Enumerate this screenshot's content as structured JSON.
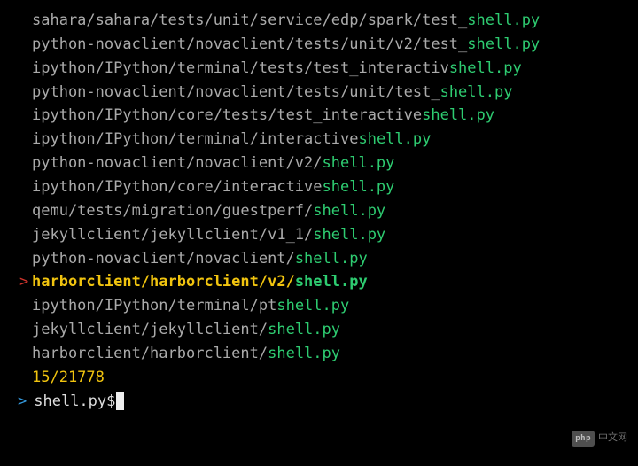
{
  "results": [
    {
      "prefix": "sahara/sahara/tests/unit/service/edp/spark/test_",
      "match": "shell.py",
      "selected": false
    },
    {
      "prefix": "python-novaclient/novaclient/tests/unit/v2/test_",
      "match": "shell.py",
      "selected": false
    },
    {
      "prefix": "ipython/IPython/terminal/tests/test_interactiv",
      "match": "shell.py",
      "selected": false
    },
    {
      "prefix": "python-novaclient/novaclient/tests/unit/test_",
      "match": "shell.py",
      "selected": false
    },
    {
      "prefix": "ipython/IPython/core/tests/test_interactive",
      "match": "shell.py",
      "selected": false
    },
    {
      "prefix": "ipython/IPython/terminal/interactive",
      "match": "shell.py",
      "selected": false
    },
    {
      "prefix": "python-novaclient/novaclient/v2/",
      "match": "shell.py",
      "selected": false
    },
    {
      "prefix": "ipython/IPython/core/interactive",
      "match": "shell.py",
      "selected": false
    },
    {
      "prefix": "qemu/tests/migration/guestperf/",
      "match": "shell.py",
      "selected": false
    },
    {
      "prefix": "jekyllclient/jekyllclient/v1_1/",
      "match": "shell.py",
      "selected": false
    },
    {
      "prefix": "python-novaclient/novaclient/",
      "match": "shell.py",
      "selected": false
    },
    {
      "prefix": "harborclient/harborclient/v2/",
      "match": "shell.py",
      "selected": true
    },
    {
      "prefix": "ipython/IPython/terminal/pt",
      "match": "shell.py",
      "selected": false
    },
    {
      "prefix": "jekyllclient/jekyllclient/",
      "match": "shell.py",
      "selected": false
    },
    {
      "prefix": "harborclient/harborclient/",
      "match": "shell.py",
      "selected": false
    }
  ],
  "count": "15/21778",
  "prompt": {
    "chevron": ">",
    "query": "shell.py$"
  },
  "watermark": {
    "badge": "php",
    "text": "中文网"
  }
}
